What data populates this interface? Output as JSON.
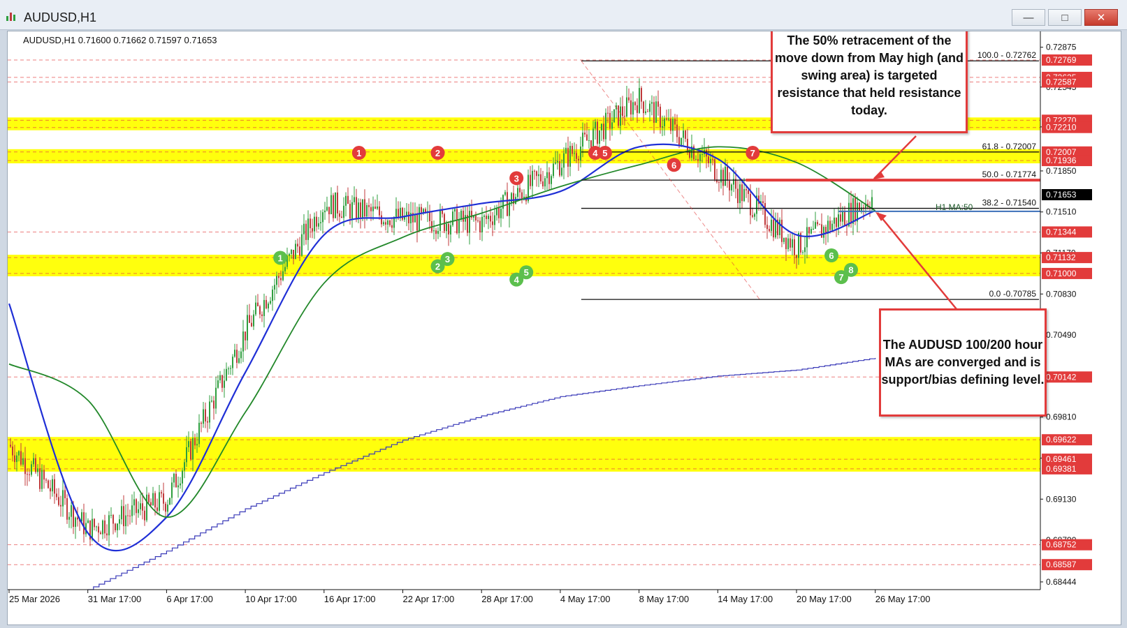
{
  "window": {
    "title": "AUDUSD,H1",
    "buttons": {
      "minimize": "—",
      "maximize": "□",
      "close": "✕"
    }
  },
  "chart_info": {
    "symbol_line": "AUDUSD,H1  0.71600 0.71662 0.71597 0.71653"
  },
  "colors": {
    "up_candle": "#2e9e3e",
    "down_candle": "#c0393b",
    "ma100": "#1f2fd6",
    "ma200": "#22882a",
    "ma_long": "#3a3ab8",
    "zone": "#ffff00",
    "red": "#e23b3b",
    "green_badge": "#5cbf4d"
  },
  "annotations": {
    "top": "The 50% retracement of the move down from May high (and swing area) is targeted resistance that held resistance today.",
    "bottom": "The AUDUSD 100/200 hour MAs are converged and is support/bias defining level."
  },
  "chart_data": {
    "type": "line",
    "x": [
      "25 Mar 2026",
      "31 Mar 17:00",
      "6 Apr 17:00",
      "10 Apr 17:00",
      "16 Apr 17:00",
      "22 Apr 17:00",
      "28 Apr 17:00",
      "4 May 17:00",
      "8 May 17:00",
      "14 May 17:00",
      "20 May 17:00",
      "26 May 17:00"
    ],
    "series": [
      {
        "values": [
          0.6958,
          0.6888,
          0.6912,
          0.7052,
          0.7158,
          0.7145,
          0.7142,
          0.7192,
          0.7245,
          0.7185,
          0.7122,
          0.7165
        ]
      },
      {
        "values": [
          0.7075,
          0.6885,
          0.6898,
          0.7018,
          0.7132,
          0.7147,
          0.7158,
          0.7168,
          0.7205,
          0.7195,
          0.7132,
          0.7152
        ]
      },
      {
        "values": [
          0.7025,
          0.6995,
          0.6898,
          0.6985,
          0.7092,
          0.713,
          0.715,
          0.7172,
          0.719,
          0.7205,
          0.7192,
          0.7152
        ]
      },
      {
        "values": [
          null,
          0.6838,
          0.687,
          0.6905,
          0.6935,
          0.6962,
          0.6982,
          0.6998,
          0.7007,
          0.7015,
          0.702,
          0.703
        ]
      }
    ],
    "y_ticks": [
      "0.72875",
      "0.72545",
      "0.72215",
      "0.71850",
      "0.71510",
      "0.71170",
      "0.70830",
      "0.70490",
      "0.70150",
      "0.69810",
      "0.69470",
      "0.69130",
      "0.68790",
      "0.68444"
    ],
    "ylim": [
      0.6838,
      0.7296
    ],
    "price_labels": [
      {
        "label": "0.72769",
        "value": 0.72769,
        "color": "#e23b3b"
      },
      {
        "label": "0.72625",
        "value": 0.72625,
        "color": "#e23b3b"
      },
      {
        "label": "0.72587",
        "value": 0.72587,
        "color": "#e23b3b"
      },
      {
        "label": "0.72270",
        "value": 0.7227,
        "color": "#e23b3b"
      },
      {
        "label": "0.72210",
        "value": 0.7221,
        "color": "#e23b3b"
      },
      {
        "label": "0.72007",
        "value": 0.72007,
        "color": "#e23b3b"
      },
      {
        "label": "0.71936",
        "value": 0.71936,
        "color": "#e23b3b"
      },
      {
        "label": "0.71653",
        "value": 0.71653,
        "color": "#000000"
      },
      {
        "label": "0.71344",
        "value": 0.71344,
        "color": "#e23b3b"
      },
      {
        "label": "0.71132",
        "value": 0.71132,
        "color": "#e23b3b"
      },
      {
        "label": "0.71000",
        "value": 0.71,
        "color": "#e23b3b"
      },
      {
        "label": "0.70142",
        "value": 0.70142,
        "color": "#e23b3b"
      },
      {
        "label": "0.69622",
        "value": 0.69622,
        "color": "#e23b3b"
      },
      {
        "label": "0.69461",
        "value": 0.69461,
        "color": "#e23b3b"
      },
      {
        "label": "0.69381",
        "value": 0.69381,
        "color": "#e23b3b"
      },
      {
        "label": "0.68752",
        "value": 0.68752,
        "color": "#e23b3b"
      },
      {
        "label": "0.68587",
        "value": 0.68587,
        "color": "#e23b3b"
      }
    ],
    "fib_levels": [
      {
        "label": "100.0 - 0.72762",
        "value": 0.72762
      },
      {
        "label": "61.8 - 0.72007",
        "value": 0.72007
      },
      {
        "label": "50.0 - 0.71774",
        "value": 0.71774
      },
      {
        "label": "38.2 - 0.71540",
        "value": 0.7154
      },
      {
        "label": "0.0 -0.70785",
        "value": 0.70785
      }
    ],
    "ma_label": "H1 MA:50",
    "zones": [
      {
        "from": 0.7221,
        "to": 0.7227
      },
      {
        "from": 0.71936,
        "to": 0.72007
      },
      {
        "from": 0.71,
        "to": 0.71132
      },
      {
        "from": 0.69381,
        "to": 0.69622
      }
    ],
    "badges": [
      {
        "text": "1",
        "kind": "red",
        "x": "16 Apr 17:00",
        "y": 0.72
      },
      {
        "text": "2",
        "kind": "red",
        "x": "22 Apr 17:00",
        "y": 0.72
      },
      {
        "text": "3",
        "kind": "red",
        "x": "28 Apr 17:00",
        "y": 0.7179
      },
      {
        "text": "4",
        "kind": "red",
        "x": "4 May 17:00",
        "y": 0.72
      },
      {
        "text": "5",
        "kind": "red",
        "x": "4 May 17:00",
        "y": 0.72
      },
      {
        "text": "6",
        "kind": "red",
        "x": "8 May 17:00",
        "y": 0.719
      },
      {
        "text": "7",
        "kind": "red",
        "x": "14 May 17:00",
        "y": 0.72
      },
      {
        "text": "1",
        "kind": "green",
        "x": "10 Apr 17:00",
        "y": 0.7113
      },
      {
        "text": "2",
        "kind": "green",
        "x": "22 Apr 17:00",
        "y": 0.7106
      },
      {
        "text": "3",
        "kind": "green",
        "x": "22 Apr 17:00",
        "y": 0.7112
      },
      {
        "text": "4",
        "kind": "green",
        "x": "28 Apr 17:00",
        "y": 0.7095
      },
      {
        "text": "5",
        "kind": "green",
        "x": "28 Apr 17:00",
        "y": 0.7101
      },
      {
        "text": "6",
        "kind": "green",
        "x": "20 May 17:00",
        "y": 0.7115
      },
      {
        "text": "7",
        "kind": "green",
        "x": "20 May 17:00",
        "y": 0.7097
      },
      {
        "text": "8",
        "kind": "green",
        "x": "20 May 17:00",
        "y": 0.7103
      }
    ]
  }
}
